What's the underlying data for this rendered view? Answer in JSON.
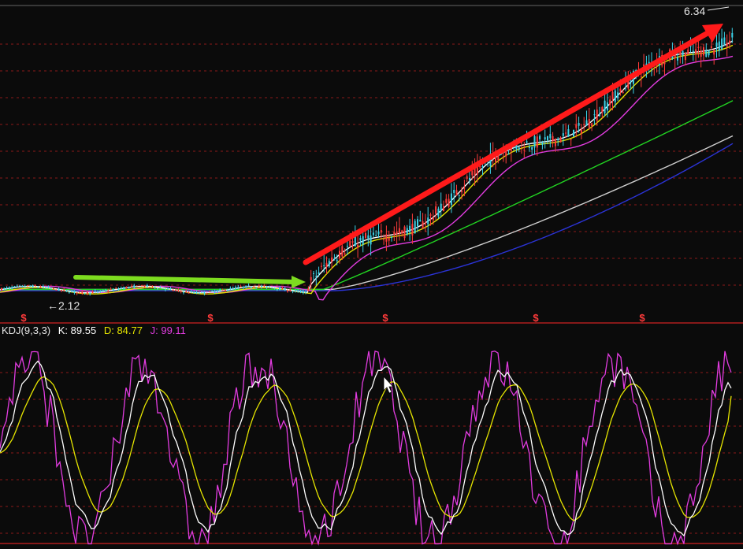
{
  "kdj": {
    "name": "KDJ(9,3,3)",
    "k_label": "K: 89.55",
    "d_label": "D: 84.77",
    "j_label": "J: 99.11"
  },
  "price": {
    "high_label": "6.34",
    "low_label": "2.12"
  },
  "colors": {
    "background": "#0b0b0b",
    "grid": "#8b1a1a",
    "k": "#ffffff",
    "d": "#e6e600",
    "j": "#e23ce0",
    "ma5": "#ffffff",
    "ma10": "#e6e600",
    "ma20": "#e23ce0",
    "ma60": "#22d522",
    "ma120": "#d0d0d0",
    "ma250": "#2b33d6",
    "candle_up": "#ff3b3b",
    "candle_down": "#3cd3e8",
    "trend_arrow": "#ff1a1a",
    "flat_arrow": "#7ddc1f",
    "marker": "#ff3b3b"
  },
  "icons": [
    "mouse-cursor-icon",
    "dollar-marker-icon"
  ],
  "chart_data": [
    {
      "type": "candlestick",
      "title": "",
      "ylim": [
        1.8,
        6.6
      ],
      "annotations": [
        "6.34",
        "2.12"
      ],
      "markers": [
        "$",
        "$",
        "$",
        "$",
        "$"
      ],
      "overlays": [
        "MA5",
        "MA10",
        "MA20",
        "MA60",
        "MA120",
        "MA250"
      ],
      "legend": "none"
    },
    {
      "type": "line",
      "title": "KDJ(9,3,3)",
      "ylim": [
        0,
        110
      ],
      "series": [
        {
          "name": "K",
          "last": 89.55
        },
        {
          "name": "D",
          "last": 84.77
        },
        {
          "name": "J",
          "last": 99.11
        }
      ]
    }
  ]
}
